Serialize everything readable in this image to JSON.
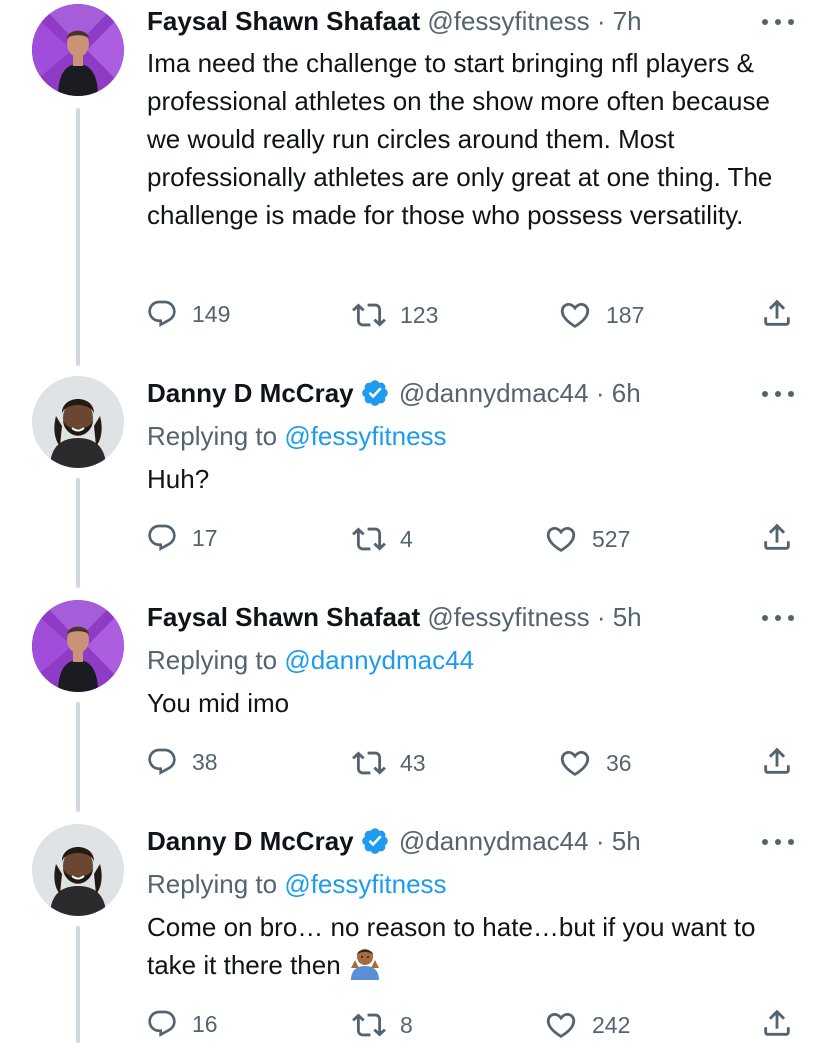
{
  "tweets": [
    {
      "name": "Faysal Shawn Shafaat",
      "handle": "@fessyfitness",
      "separator": "·",
      "time": "7h",
      "verified": false,
      "replying_label": "",
      "replying_handle": "",
      "text": "Ima need the challenge to start bringing nfl players & professional athletes on the show more often because we would really run circles around them. Most professionally athletes are only great at one thing. The challenge is made for those who possess versatility.",
      "replies": "149",
      "retweets": "123",
      "likes": "187"
    },
    {
      "name": "Danny D McCray",
      "handle": "@dannydmac44",
      "separator": "·",
      "time": "6h",
      "verified": true,
      "replying_label": "Replying to ",
      "replying_handle": "@fessyfitness",
      "text": "Huh?",
      "replies": "17",
      "retweets": "4",
      "likes": "527"
    },
    {
      "name": "Faysal Shawn Shafaat",
      "handle": "@fessyfitness",
      "separator": "·",
      "time": "5h",
      "verified": false,
      "replying_label": "Replying to ",
      "replying_handle": "@dannydmac44",
      "text": "You mid imo",
      "replies": "38",
      "retweets": "43",
      "likes": "36"
    },
    {
      "name": "Danny D McCray",
      "handle": "@dannydmac44",
      "separator": "·",
      "time": "5h",
      "verified": true,
      "replying_label": "Replying to ",
      "replying_handle": "@fessyfitness",
      "text": "Come on bro… no reason to hate…but if you want to take it there then",
      "replies": "16",
      "retweets": "8",
      "likes": "242"
    }
  ],
  "colors": {
    "text": "#0f1419",
    "muted": "#536471",
    "link": "#1d9bf0",
    "thread_line": "#cfd9de"
  },
  "icons": {
    "reply": "reply-icon",
    "retweet": "retweet-icon",
    "like": "heart-icon",
    "share": "share-icon",
    "more": "more-icon",
    "verified": "verified-badge-icon",
    "emoji": "shrug-emoji-icon"
  }
}
